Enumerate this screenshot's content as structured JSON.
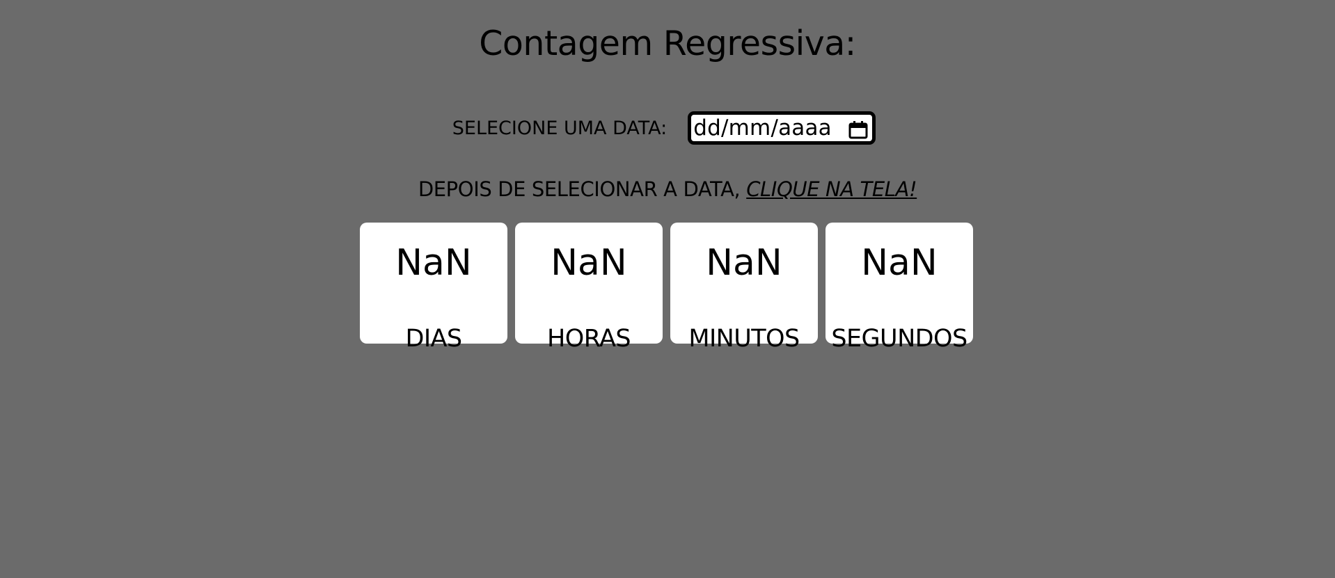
{
  "title": "Contagem Regressiva:",
  "date_picker": {
    "label": "SELECIONE UMA DATA:",
    "placeholder": "dd/mm/aaaa",
    "icon": "calendar-icon"
  },
  "instruction": {
    "text": "DEPOIS DE SELECIONAR A DATA, ",
    "cta": "CLIQUE NA TELA!"
  },
  "countdown": [
    {
      "value": "NaN",
      "unit": "DIAS"
    },
    {
      "value": "NaN",
      "unit": "HORAS"
    },
    {
      "value": "NaN",
      "unit": "MINUTOS"
    },
    {
      "value": "NaN",
      "unit": "SEGUNDOS"
    }
  ],
  "colors": {
    "background": "#6b6b6b",
    "card": "#ffffff",
    "text": "#000000"
  }
}
